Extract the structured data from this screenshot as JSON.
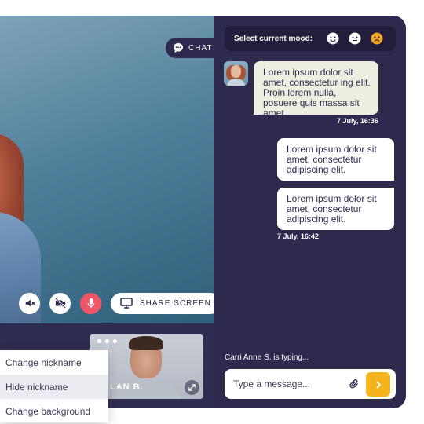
{
  "chat_tab": {
    "label": "CHAT",
    "icon": "chat-bubble-icon"
  },
  "mood": {
    "label": "Select current mood:",
    "options": [
      {
        "icon": "smile-face-icon",
        "color": "#ffffff"
      },
      {
        "icon": "neutral-face-icon",
        "color": "#ffffff"
      },
      {
        "icon": "sad-face-icon",
        "color": "#f5a623"
      }
    ]
  },
  "messages": [
    {
      "direction": "incoming",
      "text": "Lorem ipsum dolor sit amet, consectetur ing elit. Proin lorem nulla, posuere quis massa sit amet."
    },
    {
      "direction": "outgoing",
      "text": "Lorem ipsum dolor sit amet, consectetur adipiscing elit."
    },
    {
      "direction": "outgoing",
      "text": "Lorem ipsum dolor sit amet, consectetur adipiscing elit."
    }
  ],
  "timestamps": [
    "7 July, 16:36",
    "7 July, 16:42"
  ],
  "typing_indicator": "Carri Anne S. is typing...",
  "composer": {
    "placeholder": "Type a message...",
    "attach_icon": "paperclip-icon",
    "send_icon": "chevron-right-icon"
  },
  "call_controls": {
    "mute_icon": "speaker-mute-icon",
    "camera_icon": "camera-off-icon",
    "mic_icon": "microphone-icon",
    "share_label": "SHARE SCREEN",
    "share_icon": "monitor-icon"
  },
  "thumbnail": {
    "name": "LAN B.",
    "menu_icon": "more-dots-icon",
    "expand_icon": "expand-icon"
  },
  "context_menu": {
    "items": [
      "Change nickname",
      "Hide nickname",
      "Change background"
    ],
    "active_index": 1
  },
  "colors": {
    "panel": "#2d2a4e",
    "mood_bar": "#211e3c",
    "incoming_bubble": "#eeeee1",
    "outgoing_bubble": "#ffffff",
    "send_button": "#f5b31d",
    "mic_button": "#ee5566"
  }
}
